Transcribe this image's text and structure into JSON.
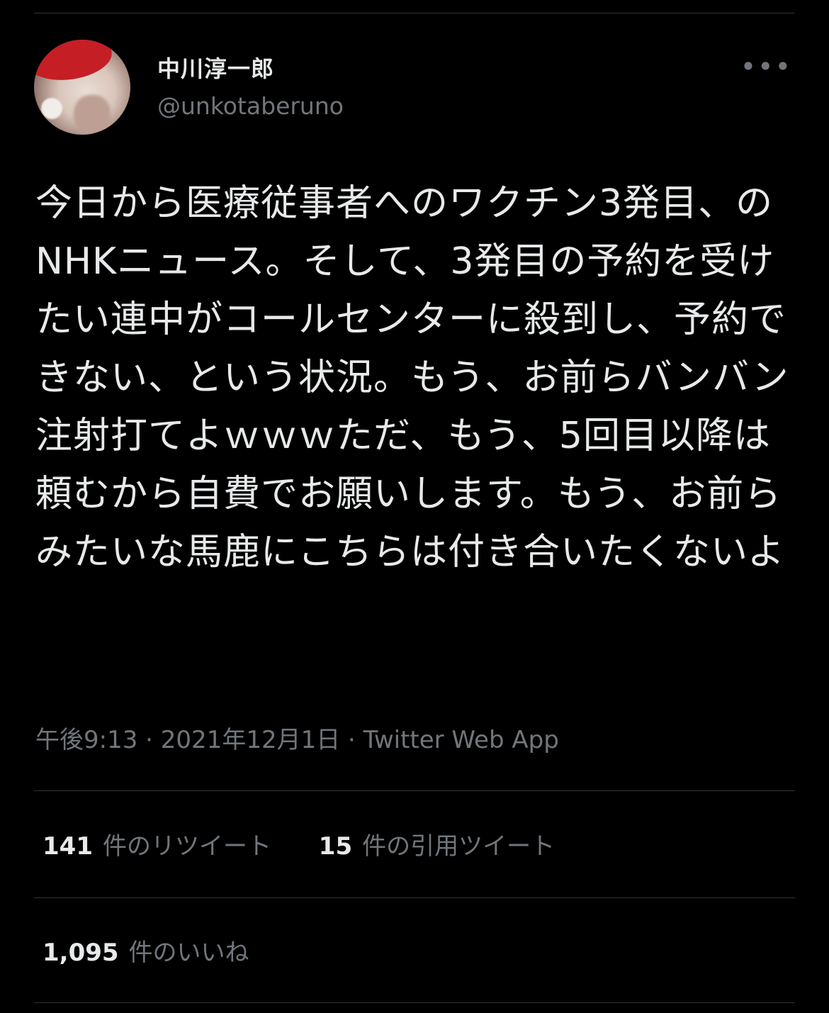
{
  "author": {
    "display_name": "中川淳一郎",
    "handle": "@unkotaberuno",
    "avatar_icon": "avatar-photo-icon"
  },
  "header": {
    "more_icon_glyph": "•••"
  },
  "tweet": {
    "text": "今日から医療従事者へのワクチン3発目、のNHKニュース。そして、3発目の予約を受けたい連中がコールセンターに殺到し、予約できない、という状況。もう、お前らバンバン注射打てよｗｗｗただ、もう、5回目以降は頼むから自費でお願いします。もう、お前らみたいな馬鹿にこちらは付き合いたくないよ"
  },
  "meta": {
    "time": "午後9:13",
    "separator": " · ",
    "date": "2021年12月1日",
    "source": "Twitter Web App"
  },
  "stats": {
    "retweets": {
      "count": "141",
      "label": "件のリツイート"
    },
    "quotes": {
      "count": "15",
      "label": "件の引用ツイート"
    },
    "likes": {
      "count": "1,095",
      "label": "件のいいね"
    }
  },
  "colors": {
    "background": "#000000",
    "text": "#e7e9ea",
    "secondary": "#71767b",
    "divider": "#2f3336"
  }
}
